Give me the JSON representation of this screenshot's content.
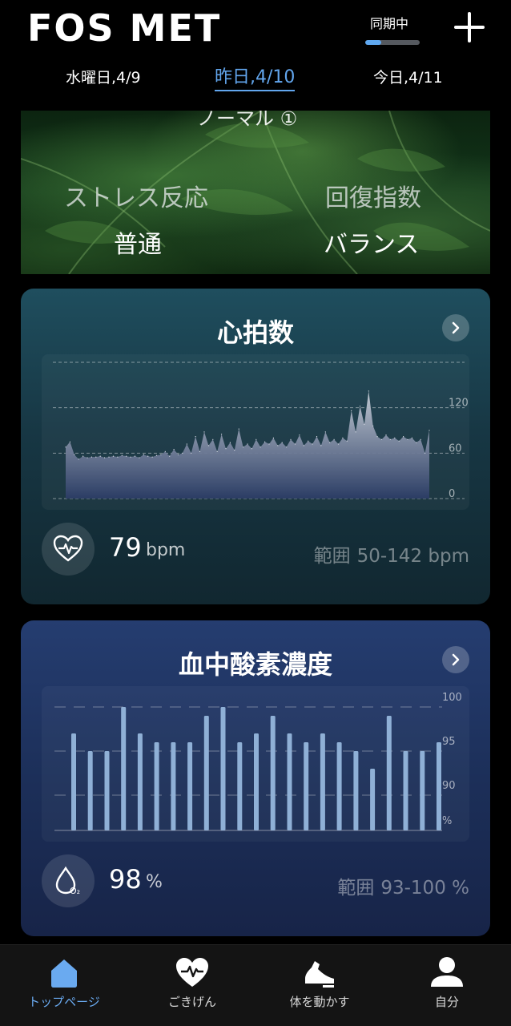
{
  "app": {
    "logo": "FOS MET"
  },
  "sync": {
    "label": "同期中",
    "progress": 0.3
  },
  "dates": {
    "prev": "水曜日,4/9",
    "current": "昨日,4/10",
    "next": "今日,4/11"
  },
  "hero": {
    "top_partial": "ノーマル ①",
    "stress_label": "ストレス反応",
    "stress_value": "普通",
    "recovery_label": "回復指数",
    "recovery_value": "バランス"
  },
  "heart_rate": {
    "title": "心拍数",
    "value": "79",
    "unit": "bpm",
    "range_label": "範囲",
    "range_value": "50-142 bpm",
    "axis_labels": [
      "120",
      "60",
      "0"
    ]
  },
  "spo2": {
    "title": "血中酸素濃度",
    "value": "98",
    "unit": "%",
    "range_label": "範囲",
    "range_value": "93-100 %",
    "axis_labels": [
      "100",
      "95",
      "90",
      "%"
    ]
  },
  "chart_data": [
    {
      "type": "area",
      "title": "心拍数",
      "ylim": [
        0,
        180
      ],
      "yticks": [
        0,
        60,
        120
      ],
      "values": [
        68,
        75,
        58,
        52,
        56,
        54,
        55,
        55,
        56,
        54,
        55,
        56,
        55,
        57,
        56,
        55,
        56,
        54,
        58,
        56,
        55,
        57,
        58,
        62,
        56,
        65,
        58,
        60,
        72,
        60,
        82,
        62,
        88,
        70,
        78,
        62,
        85,
        66,
        74,
        64,
        92,
        68,
        72,
        66,
        78,
        68,
        75,
        72,
        80,
        70,
        74,
        68,
        78,
        72,
        84,
        70,
        76,
        72,
        82,
        70,
        88,
        74,
        78,
        72,
        80,
        76,
        116,
        88,
        122,
        98,
        142,
        96,
        82,
        78,
        84,
        78,
        80,
        76,
        82,
        78,
        80,
        74,
        78,
        60,
        90
      ],
      "grid": true
    },
    {
      "type": "bar",
      "title": "血中酸素濃度",
      "ylim": [
        86,
        100
      ],
      "yticks": [
        90,
        95,
        100
      ],
      "values": [
        97,
        95,
        95,
        100,
        97,
        96,
        96,
        96,
        99,
        100,
        96,
        97,
        99,
        97,
        96,
        97,
        96,
        95,
        93,
        99,
        95,
        95,
        96
      ],
      "grid": true
    }
  ],
  "nav": {
    "items": [
      {
        "label": "トップページ",
        "active": true
      },
      {
        "label": "ごきげん",
        "active": false
      },
      {
        "label": "体を動かす",
        "active": false
      },
      {
        "label": "自分",
        "active": false
      }
    ],
    "active_color": "#6aaaf0"
  }
}
